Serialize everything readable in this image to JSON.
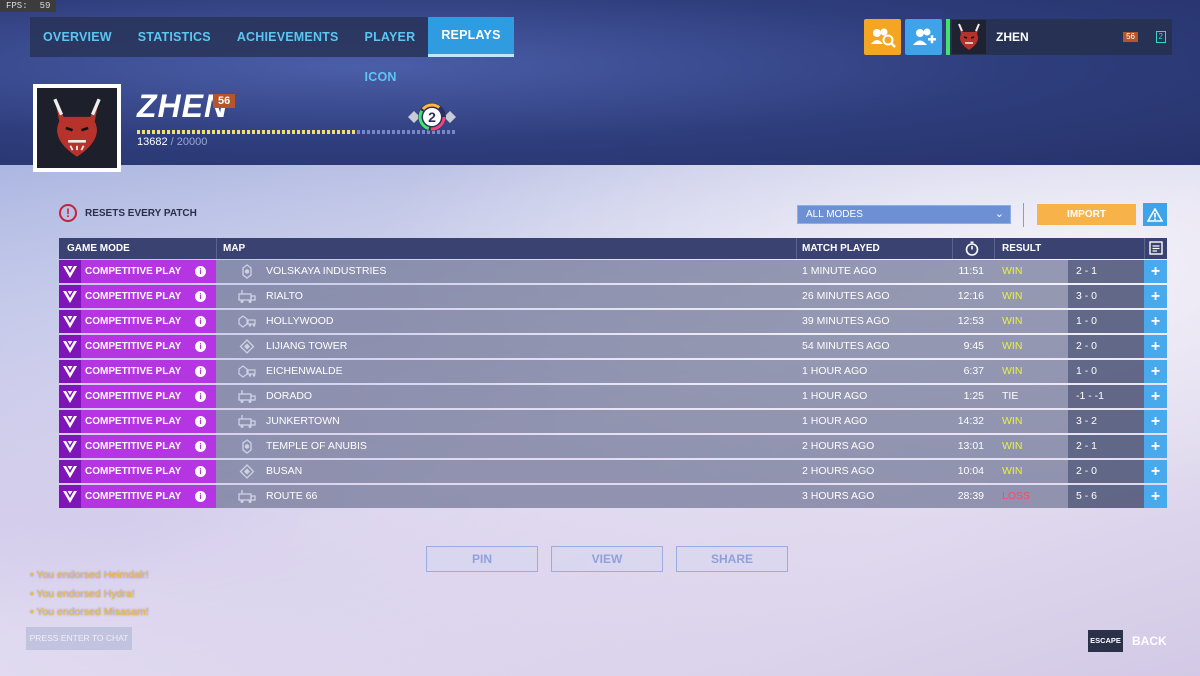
{
  "fps": {
    "label": "FPS:",
    "value": "59"
  },
  "nav": {
    "tabs": [
      {
        "label": "OVERVIEW"
      },
      {
        "label": "STATISTICS"
      },
      {
        "label": "ACHIEVEMENTS"
      },
      {
        "label": "PLAYER ICON"
      },
      {
        "label": "REPLAYS"
      }
    ],
    "active_tab": "REPLAYS"
  },
  "social": {
    "find_icon": "find-group-icon",
    "group_icon": "add-friend-icon"
  },
  "user_chip": {
    "name": "ZHEN",
    "level": "56",
    "rank": "2"
  },
  "profile": {
    "name": "ZHEN",
    "level": "56",
    "xp_current": "13682",
    "xp_max": "20000",
    "xp_progress": 0.684,
    "endorsement_level": "2"
  },
  "notice": {
    "text": "RESETS EVERY PATCH",
    "icon": "alert-circle-icon"
  },
  "filter": {
    "selected": "ALL MODES"
  },
  "import": {
    "label": "IMPORT"
  },
  "colors": {
    "win": "#e8f23a",
    "tie": "#ffffff",
    "loss": "#ff4a5e",
    "mode": "#b535e3",
    "accent": "#3ea3e8"
  },
  "table": {
    "headers": {
      "game_mode": "GAME MODE",
      "map": "MAP",
      "match_played": "MATCH PLAYED",
      "result": "RESULT"
    },
    "rows": [
      {
        "mode": "COMPETITIVE PLAY",
        "map": "VOLSKAYA INDUSTRIES",
        "map_type": "assault",
        "played": "1 MINUTE AGO",
        "duration": "11:51",
        "result": "WIN",
        "score": "2 - 1"
      },
      {
        "mode": "COMPETITIVE PLAY",
        "map": "RIALTO",
        "map_type": "escort",
        "played": "26 MINUTES AGO",
        "duration": "12:16",
        "result": "WIN",
        "score": "3 - 0"
      },
      {
        "mode": "COMPETITIVE PLAY",
        "map": "HOLLYWOOD",
        "map_type": "hybrid",
        "played": "39 MINUTES AGO",
        "duration": "12:53",
        "result": "WIN",
        "score": "1 - 0"
      },
      {
        "mode": "COMPETITIVE PLAY",
        "map": "LIJIANG TOWER",
        "map_type": "control",
        "played": "54 MINUTES AGO",
        "duration": "9:45",
        "result": "WIN",
        "score": "2 - 0"
      },
      {
        "mode": "COMPETITIVE PLAY",
        "map": "EICHENWALDE",
        "map_type": "hybrid",
        "played": "1 HOUR AGO",
        "duration": "6:37",
        "result": "WIN",
        "score": "1 - 0"
      },
      {
        "mode": "COMPETITIVE PLAY",
        "map": "DORADO",
        "map_type": "escort",
        "played": "1 HOUR AGO",
        "duration": "1:25",
        "result": "TIE",
        "score": "-1 - -1"
      },
      {
        "mode": "COMPETITIVE PLAY",
        "map": "JUNKERTOWN",
        "map_type": "escort",
        "played": "1 HOUR AGO",
        "duration": "14:32",
        "result": "WIN",
        "score": "3 - 2"
      },
      {
        "mode": "COMPETITIVE PLAY",
        "map": "TEMPLE OF ANUBIS",
        "map_type": "assault",
        "played": "2 HOURS AGO",
        "duration": "13:01",
        "result": "WIN",
        "score": "2 - 1"
      },
      {
        "mode": "COMPETITIVE PLAY",
        "map": "BUSAN",
        "map_type": "control",
        "played": "2 HOURS AGO",
        "duration": "10:04",
        "result": "WIN",
        "score": "2 - 0"
      },
      {
        "mode": "COMPETITIVE PLAY",
        "map": "ROUTE 66",
        "map_type": "escort",
        "played": "3 HOURS AGO",
        "duration": "28:39",
        "result": "LOSS",
        "score": "5 - 6"
      }
    ]
  },
  "actions": {
    "pin": "PIN",
    "view": "VIEW",
    "share": "SHARE"
  },
  "chat_log": [
    "You endorsed Heimdalr!",
    "You endorsed Hydra!",
    "You endorsed Misasam!"
  ],
  "chat": {
    "prompt": "PRESS ENTER TO CHAT"
  },
  "footer": {
    "escape_key": "ESCAPE",
    "back": "BACK"
  }
}
